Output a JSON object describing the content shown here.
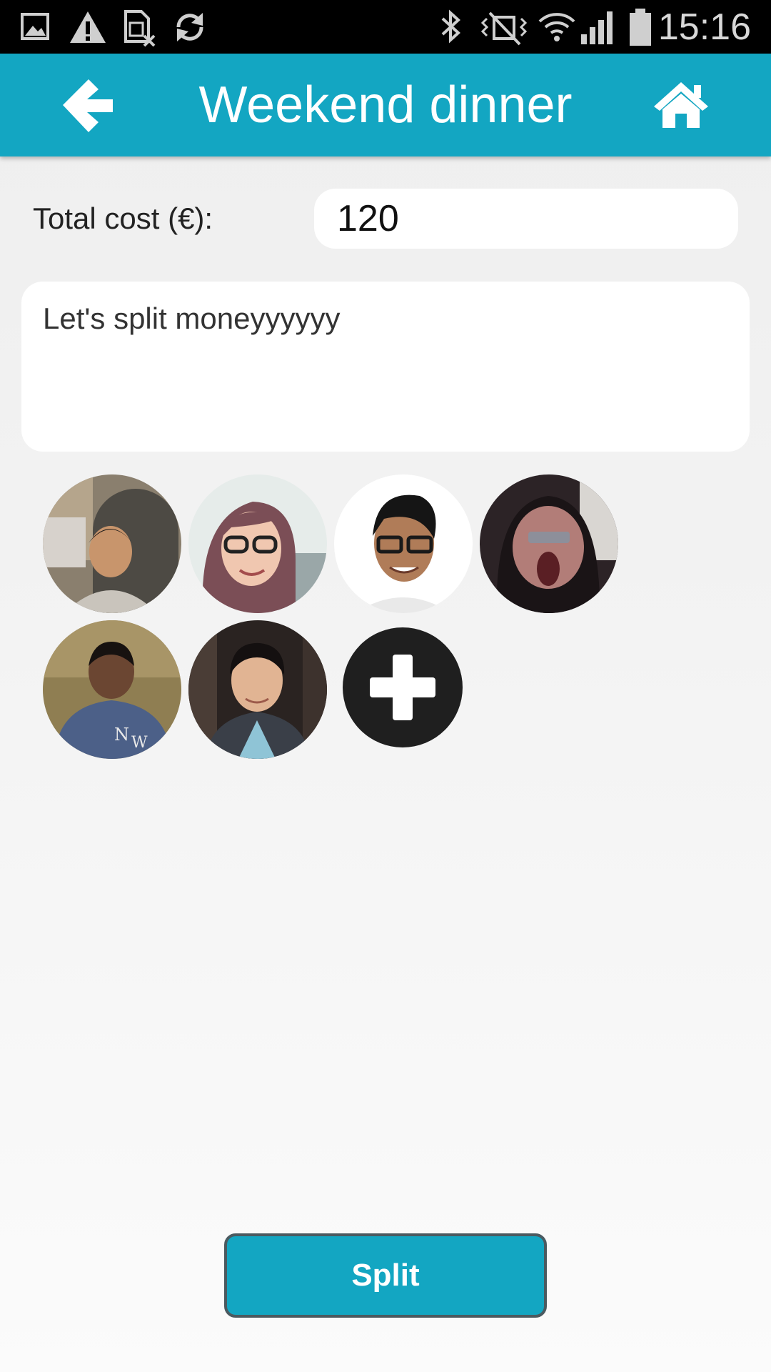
{
  "status_bar": {
    "time": "15:16",
    "left_icons": [
      "image-icon",
      "warning-icon",
      "sim-off-icon",
      "sync-icon"
    ],
    "right_icons": [
      "bluetooth-icon",
      "vibrate-icon",
      "wifi-icon",
      "signal-icon",
      "battery-icon"
    ]
  },
  "app_bar": {
    "title": "Weekend dinner",
    "back_icon": "arrow-left-icon",
    "home_icon": "home-icon",
    "color": "#13a6c2"
  },
  "form": {
    "total_cost_label": "Total cost (€):",
    "total_cost_value": "120",
    "description": "Let's split moneyyyyyy"
  },
  "participants": {
    "avatars": [
      {
        "name": "participant-avatar-1"
      },
      {
        "name": "participant-avatar-2"
      },
      {
        "name": "participant-avatar-3"
      },
      {
        "name": "participant-avatar-4"
      },
      {
        "name": "participant-avatar-5"
      },
      {
        "name": "participant-avatar-6"
      }
    ],
    "add_icon": "plus-icon"
  },
  "actions": {
    "split_label": "Split"
  }
}
